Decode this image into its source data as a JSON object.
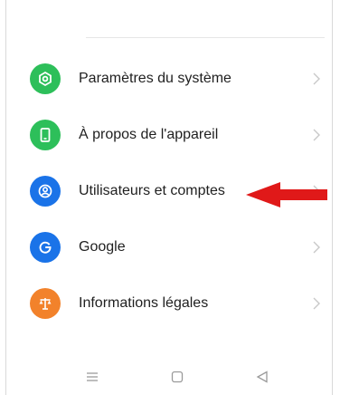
{
  "settings": {
    "items": [
      {
        "label": "Paramètres du système",
        "icon": "gear-icon",
        "color": "#2dbf5a"
      },
      {
        "label": "À propos de l'appareil",
        "icon": "phone-icon",
        "color": "#2dbf5a"
      },
      {
        "label": "Utilisateurs et comptes",
        "icon": "user-icon",
        "color": "#1a73e8"
      },
      {
        "label": "Google",
        "icon": "google-icon",
        "color": "#1a73e8"
      },
      {
        "label": "Informations légales",
        "icon": "scales-icon",
        "color": "#f2822b"
      }
    ]
  },
  "annotation": {
    "icon": "red-arrow-icon",
    "color": "#e01919"
  },
  "navigation": {
    "buttons": [
      "menu-icon",
      "home-icon",
      "back-icon"
    ]
  }
}
